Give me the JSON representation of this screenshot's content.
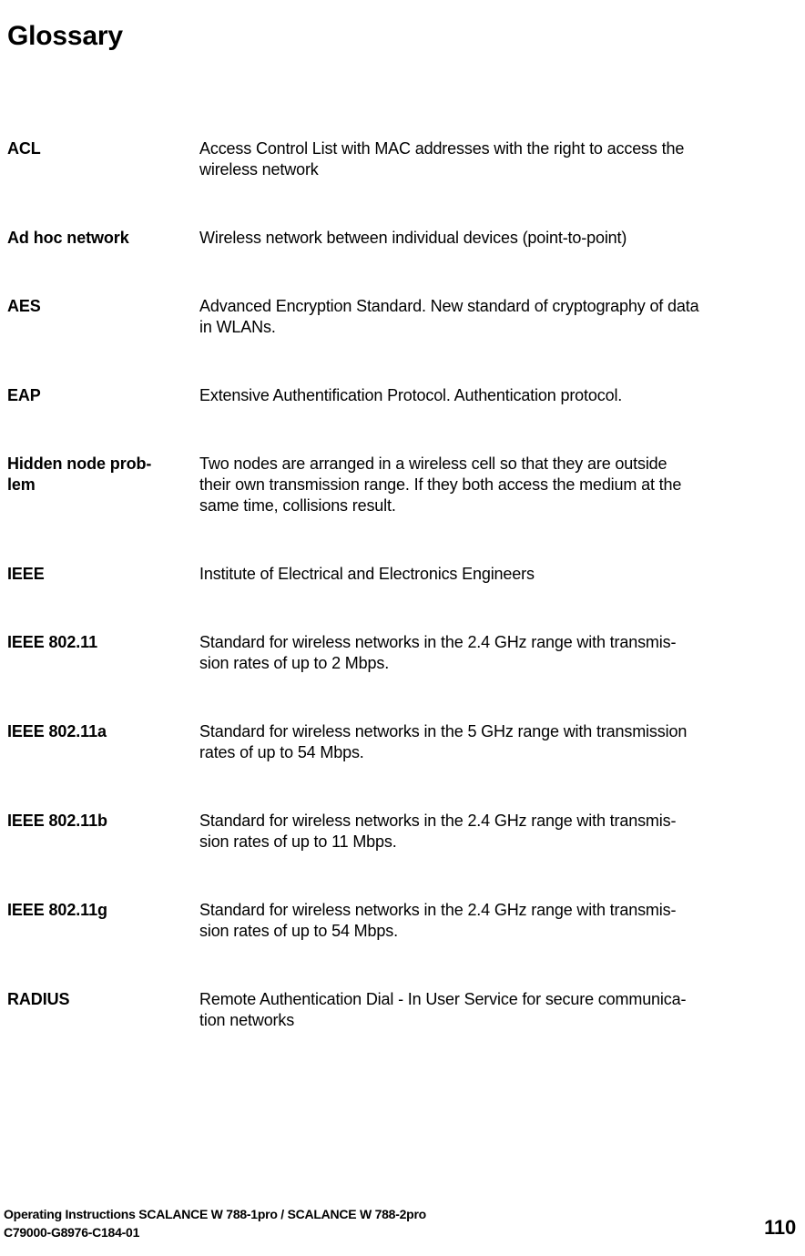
{
  "document": {
    "title": "Glossary"
  },
  "glossary": {
    "entries": [
      {
        "term_lines": [
          "ACL"
        ],
        "definition_lines": [
          "Access Control List with MAC addresses with the right to access the",
          "wireless network"
        ]
      },
      {
        "term_lines": [
          "Ad hoc network"
        ],
        "definition_lines": [
          "Wireless network between individual devices (point-to-point)"
        ]
      },
      {
        "term_lines": [
          "AES"
        ],
        "definition_lines": [
          "Advanced Encryption Standard. New standard of cryptography of data",
          "in WLANs."
        ]
      },
      {
        "term_lines": [
          "EAP"
        ],
        "definition_lines": [
          "Extensive Authentification Protocol. Authentication protocol."
        ]
      },
      {
        "term_lines": [
          "Hidden node prob-",
          "lem"
        ],
        "definition_lines": [
          "Two nodes are arranged in a wireless cell so that they are outside",
          "their own transmission range. If they both access the medium at the",
          "same time, collisions result."
        ]
      },
      {
        "term_lines": [
          "IEEE"
        ],
        "definition_lines": [
          "Institute of Electrical and Electronics Engineers"
        ]
      },
      {
        "term_lines": [
          "IEEE 802.11"
        ],
        "definition_lines": [
          "Standard for wireless networks in the 2.4 GHz range with transmis-",
          "sion rates of up to 2 Mbps."
        ]
      },
      {
        "term_lines": [
          "IEEE 802.11a"
        ],
        "definition_lines": [
          "Standard for wireless networks in the 5 GHz range with transmission",
          "rates of up to 54 Mbps."
        ]
      },
      {
        "term_lines": [
          "IEEE 802.11b"
        ],
        "definition_lines": [
          "Standard for wireless networks in the 2.4 GHz range with transmis-",
          "sion rates of up to 11 Mbps."
        ]
      },
      {
        "term_lines": [
          "IEEE 802.11g"
        ],
        "definition_lines": [
          "Standard for wireless networks in the 2.4 GHz range with transmis-",
          "sion rates of up to 54 Mbps."
        ]
      },
      {
        "term_lines": [
          "RADIUS"
        ],
        "definition_lines": [
          "Remote Authentication Dial - In User Service for secure communica-",
          "tion networks"
        ]
      }
    ]
  },
  "footer": {
    "title": "Operating Instructions SCALANCE W 788-1pro / SCALANCE W 788-2pro",
    "order_number": "C79000-G8976-C184-01",
    "page_number": "110"
  }
}
